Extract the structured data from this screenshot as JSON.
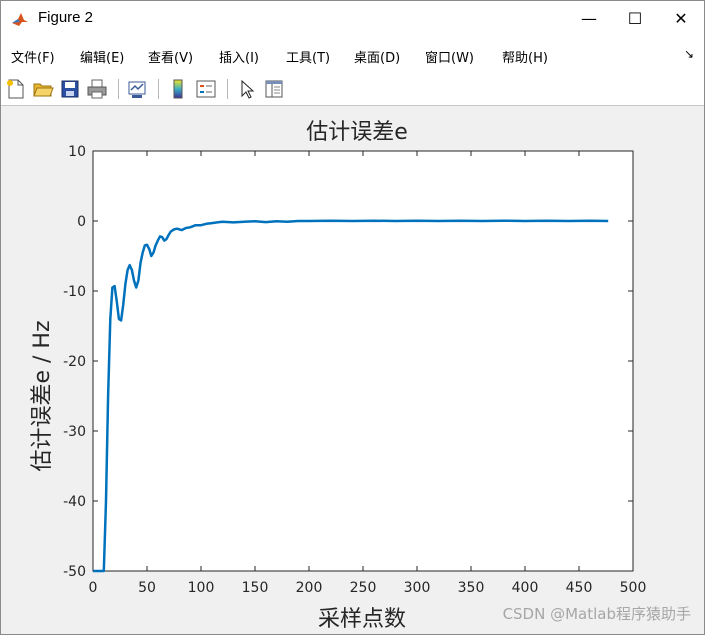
{
  "window": {
    "title": "Figure 2",
    "minimize_glyph": "—",
    "maximize_glyph": "☐",
    "close_glyph": "✕"
  },
  "menu": {
    "items": [
      "文件(F)",
      "编辑(E)",
      "查看(V)",
      "插入(I)",
      "工具(T)",
      "桌面(D)",
      "窗口(W)",
      "帮助(H)"
    ],
    "dock_arrow": "↘"
  },
  "toolbar": {
    "buttons": [
      "new-figure-icon",
      "open-file-icon",
      "save-icon",
      "print-icon",
      "link-plot-icon",
      "colorbar-icon",
      "legend-icon",
      "pointer-icon",
      "property-editor-icon"
    ]
  },
  "colors": {
    "line": "#0072BD",
    "axes_bg": "#ffffff",
    "figure_bg": "#f0f0f0"
  },
  "chart_data": {
    "type": "line",
    "title": "估计误差e",
    "xlabel": "采样点数",
    "ylabel": "估计误差e / Hz",
    "xlim": [
      0,
      500
    ],
    "ylim": [
      -50,
      10
    ],
    "xticks": [
      "0",
      "50",
      "100",
      "150",
      "200",
      "250",
      "300",
      "350",
      "400",
      "450",
      "500"
    ],
    "yticks": [
      "10",
      "0",
      "-10",
      "-20",
      "-30",
      "-40",
      "-50"
    ],
    "grid": false,
    "series": [
      {
        "x": [
          0,
          10,
          12,
          14,
          16,
          18,
          20,
          22,
          24,
          26,
          28,
          30,
          32,
          34,
          36,
          38,
          40,
          42,
          44,
          46,
          48,
          50,
          52,
          54,
          56,
          58,
          60,
          62,
          64,
          66,
          68,
          70,
          72,
          75,
          78,
          82,
          86,
          90,
          95,
          100,
          105,
          110,
          115,
          120,
          130,
          140,
          150,
          160,
          170,
          180,
          190,
          200,
          220,
          240,
          260,
          280,
          300,
          320,
          340,
          360,
          380,
          400,
          420,
          440,
          460,
          477
        ],
        "y": [
          -50,
          -50,
          -40,
          -25,
          -14,
          -9.5,
          -9.3,
          -11.5,
          -14,
          -14.2,
          -12,
          -9,
          -7,
          -6.3,
          -7,
          -8.5,
          -9.5,
          -8.5,
          -6,
          -4.5,
          -3.5,
          -3.4,
          -4,
          -5,
          -4.5,
          -3.5,
          -2.8,
          -2.2,
          -2.3,
          -2.8,
          -2.6,
          -2,
          -1.5,
          -1.2,
          -1.1,
          -1.3,
          -1.0,
          -0.9,
          -0.6,
          -0.6,
          -0.4,
          -0.3,
          -0.2,
          -0.1,
          -0.2,
          -0.1,
          -0.05,
          -0.15,
          -0.05,
          -0.1,
          0,
          0,
          0.05,
          0,
          0.05,
          0,
          0.05,
          0,
          0.05,
          0,
          0.05,
          0,
          0.05,
          0,
          0.05,
          0
        ]
      }
    ]
  },
  "watermark": "CSDN @Matlab程序猿助手"
}
